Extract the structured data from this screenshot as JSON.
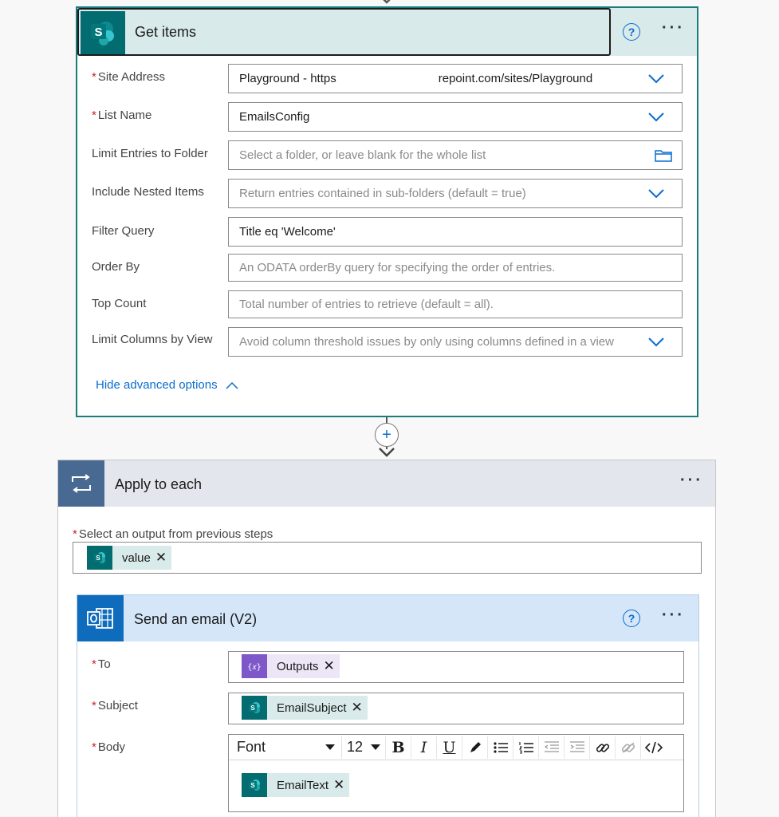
{
  "get_items": {
    "title": "Get items",
    "fields": [
      {
        "label": "Site Address",
        "required": true,
        "value_left": "Playground - https",
        "value_right": "repoint.com/sites/Playground",
        "type": "dropdown"
      },
      {
        "label": "List Name",
        "required": true,
        "value": "EmailsConfig",
        "type": "dropdown"
      },
      {
        "label": "Limit Entries to Folder",
        "required": false,
        "placeholder": "Select a folder, or leave blank for the whole list",
        "type": "folder"
      },
      {
        "label": "Include Nested Items",
        "required": false,
        "placeholder": "Return entries contained in sub-folders (default = true)",
        "type": "dropdown"
      },
      {
        "label": "Filter Query",
        "required": false,
        "value": "Title eq 'Welcome'",
        "type": "text"
      },
      {
        "label": "Order By",
        "required": false,
        "placeholder": "An ODATA orderBy query for specifying the order of entries.",
        "type": "text"
      },
      {
        "label": "Top Count",
        "required": false,
        "placeholder": "Total number of entries to retrieve (default = all).",
        "type": "text"
      },
      {
        "label": "Limit Columns by View",
        "required": false,
        "placeholder": "Avoid column threshold issues by only using columns defined in a view",
        "type": "dropdown"
      }
    ],
    "hide_advanced": "Hide advanced options"
  },
  "apply_to_each": {
    "title": "Apply to each",
    "select_label": "Select an output from previous steps",
    "token": "value"
  },
  "send_email": {
    "title": "Send an email (V2)",
    "to_label": "To",
    "to_token": "Outputs",
    "subject_label": "Subject",
    "subject_token": "EmailSubject",
    "body_label": "Body",
    "font_label": "Font",
    "font_size": "12",
    "body_token": "EmailText"
  },
  "icons": {
    "sharepoint": "sharepoint-icon",
    "loop": "loop-icon",
    "outlook": "outlook-icon",
    "help": "help-icon",
    "more": "more-icon",
    "expression": "expression-icon"
  },
  "colors": {
    "sharepoint": "#036c70",
    "loop": "#486991",
    "outlook": "#0f6cbd",
    "expression": "#7e58c9",
    "link": "#0a6cce",
    "required": "#c4262e"
  },
  "glyphs": {
    "required": "*",
    "question": "?",
    "more": "···",
    "close": "✕",
    "plus": "+",
    "sp_letter": "S",
    "bold": "B",
    "italic": "I",
    "underline": "U"
  }
}
